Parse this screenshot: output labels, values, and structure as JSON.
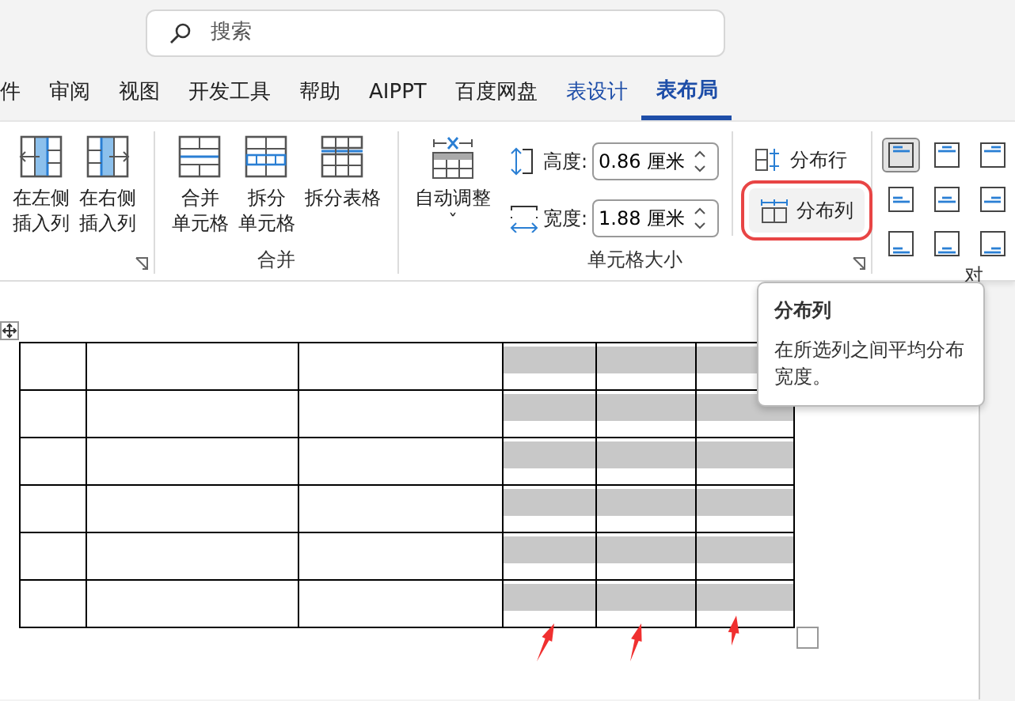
{
  "search": {
    "placeholder": "搜索"
  },
  "tabs": [
    {
      "label": "件",
      "selected": false,
      "contextual": false
    },
    {
      "label": "审阅",
      "selected": false,
      "contextual": false
    },
    {
      "label": "视图",
      "selected": false,
      "contextual": false
    },
    {
      "label": "开发工具",
      "selected": false,
      "contextual": false
    },
    {
      "label": "帮助",
      "selected": false,
      "contextual": false
    },
    {
      "label": "AIPPT",
      "selected": false,
      "contextual": false
    },
    {
      "label": "百度网盘",
      "selected": false,
      "contextual": false
    },
    {
      "label": "表设计",
      "selected": false,
      "contextual": true
    },
    {
      "label": "表布局",
      "selected": true,
      "contextual": true
    }
  ],
  "ribbon": {
    "insert_group": {
      "buttons": [
        {
          "lines": [
            "在左侧",
            "插入列"
          ],
          "kind": "insert-left"
        },
        {
          "lines": [
            "在右侧",
            "插入列"
          ],
          "kind": "insert-right"
        }
      ]
    },
    "merge_group": {
      "label": "合并",
      "buttons": [
        {
          "lines": [
            "合并",
            "单元格"
          ],
          "kind": "merge"
        },
        {
          "lines": [
            "拆分",
            "单元格"
          ],
          "kind": "split"
        },
        {
          "lines": [
            "拆分表格"
          ],
          "kind": "split-table"
        }
      ]
    },
    "cell_size_group": {
      "label": "单元格大小",
      "autofit": {
        "label": "自动调整",
        "caret": "ˇ"
      },
      "height": {
        "label": "高度:",
        "value": "0.86 厘米"
      },
      "width": {
        "label": "宽度:",
        "value": "1.88 厘米"
      },
      "distribute_rows": {
        "label": "分布行",
        "hovered": false
      },
      "distribute_columns": {
        "label": "分布列",
        "hovered": true
      }
    },
    "alignment_group": {
      "label": "对",
      "buttons": [
        {
          "selected": true
        },
        {
          "selected": false
        },
        {
          "selected": false
        },
        {
          "selected": false
        },
        {
          "selected": false
        },
        {
          "selected": false
        },
        {
          "selected": false
        },
        {
          "selected": false
        },
        {
          "selected": false
        }
      ]
    }
  },
  "tooltip": {
    "title": "分布列",
    "text": "在所选列之间平均分布宽度。"
  },
  "table": {
    "rows": [
      {
        "cells": [
          {
            "selected": false
          },
          {
            "selected": false
          },
          {
            "selected": false
          },
          {
            "selected": true
          },
          {
            "selected": true
          },
          {
            "selected": true
          }
        ]
      },
      {
        "cells": [
          {
            "selected": false
          },
          {
            "selected": false
          },
          {
            "selected": false
          },
          {
            "selected": true
          },
          {
            "selected": true
          },
          {
            "selected": true
          }
        ]
      },
      {
        "cells": [
          {
            "selected": false
          },
          {
            "selected": false
          },
          {
            "selected": false
          },
          {
            "selected": true
          },
          {
            "selected": true
          },
          {
            "selected": true
          }
        ]
      },
      {
        "cells": [
          {
            "selected": false
          },
          {
            "selected": false
          },
          {
            "selected": false
          },
          {
            "selected": true
          },
          {
            "selected": true
          },
          {
            "selected": true
          }
        ]
      },
      {
        "cells": [
          {
            "selected": false
          },
          {
            "selected": false
          },
          {
            "selected": false
          },
          {
            "selected": true
          },
          {
            "selected": true
          },
          {
            "selected": true
          }
        ]
      },
      {
        "cells": [
          {
            "selected": false
          },
          {
            "selected": false
          },
          {
            "selected": false
          },
          {
            "selected": true
          },
          {
            "selected": true
          },
          {
            "selected": true
          }
        ]
      }
    ]
  }
}
